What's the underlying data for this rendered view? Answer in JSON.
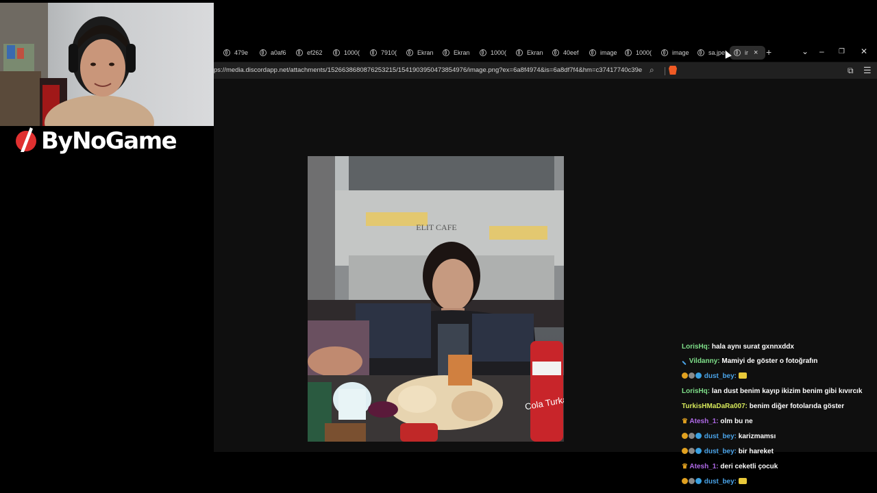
{
  "browser": {
    "tabs": [
      {
        "label": "479e"
      },
      {
        "label": "a0af6"
      },
      {
        "label": "ef262"
      },
      {
        "label": "1000("
      },
      {
        "label": "7910("
      },
      {
        "label": "Ekran"
      },
      {
        "label": "Ekran"
      },
      {
        "label": "1000("
      },
      {
        "label": "Ekran"
      },
      {
        "label": "40eef"
      },
      {
        "label": "image"
      },
      {
        "label": "1000("
      },
      {
        "label": "image"
      },
      {
        "label": "sa.jpe"
      },
      {
        "label": "ir",
        "active": true
      }
    ],
    "url": "ps://media.discordapp.net/attachments/1526638680876253215/1541903950473854976/image.png?ex=6a8f4974&is=6a8df7f4&hm=c37417740c39e0...",
    "new_tab_icon": "+",
    "close_tab_icon": "×"
  },
  "overlay": {
    "brand": "ByNoGame"
  },
  "chat": {
    "messages": [
      {
        "user": "LorisHq:",
        "color": "#7fe08a",
        "text": "hala aynı surat gxnnxddx",
        "badges": []
      },
      {
        "user": "Vildanny:",
        "color": "#7fe08a",
        "text": "Mamiyi de göster o fotoğrafın",
        "badges": [
          "sword"
        ]
      },
      {
        "user": "dust_bey:",
        "color": "#4aa3e8",
        "text": "",
        "badges": [
          "gold",
          "gray",
          "blue"
        ],
        "emote": true
      },
      {
        "user": "LorisHq:",
        "color": "#7fe08a",
        "text": "lan dust benim kayıp ikizim benim gibi kıvırcık",
        "badges": []
      },
      {
        "user": "TurkisHMaDaRa007:",
        "color": "#d6e85a",
        "text": "benim diğer fotolarıda göster",
        "badges": []
      },
      {
        "user": "Atesh_1:",
        "color": "#b06ae8",
        "text": "olm bu ne",
        "badges": [
          "crown"
        ]
      },
      {
        "user": "dust_bey:",
        "color": "#4aa3e8",
        "text": "karizmamsı",
        "badges": [
          "gold",
          "gray",
          "blue"
        ]
      },
      {
        "user": "dust_bey:",
        "color": "#4aa3e8",
        "text": "bir hareket",
        "badges": [
          "gold",
          "gray",
          "blue"
        ]
      },
      {
        "user": "Atesh_1:",
        "color": "#b06ae8",
        "text": "deri ceketli çocuk",
        "badges": [
          "crown"
        ]
      },
      {
        "user": "dust_bey:",
        "color": "#4aa3e8",
        "text": "",
        "badges": [
          "gold",
          "gray",
          "blue"
        ],
        "emote": true
      }
    ]
  },
  "photo": {
    "sign_text": "ELIT CAFE",
    "can_text": "Cola Turka"
  },
  "colors": {
    "background": "#000000",
    "viewer": "#0f0f0f",
    "tab_active": "#2d2d2d",
    "address_bar": "#202020"
  }
}
